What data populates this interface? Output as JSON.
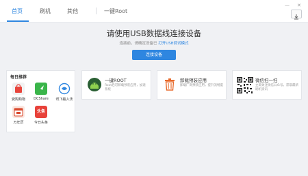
{
  "tabs": [
    {
      "label": "首页"
    },
    {
      "label": "刷机"
    },
    {
      "label": "其他"
    },
    {
      "label": "一键Root"
    }
  ],
  "window_controls": {
    "minimize": "—",
    "close": "✕"
  },
  "hero": {
    "title": "请使用USB数据线连接设备",
    "subtitle_prefix": "连接前，请确定设备已",
    "subtitle_link": "打开USB调试模式",
    "connect_button": "连接设备"
  },
  "daily": {
    "title": "每日推荐",
    "apps": [
      {
        "label": "受购购物",
        "icon": "shopping-bag-icon"
      },
      {
        "label": "DCShare",
        "icon": "dcshare-icon"
      },
      {
        "label": "讯飞输入法",
        "icon": "ifly-input-icon"
      },
      {
        "label": "万年历",
        "icon": "calendar-icon"
      },
      {
        "label": "今日头条",
        "icon": "toutiao-icon",
        "badge": "头条"
      }
    ]
  },
  "cards": [
    {
      "title": "一键ROOT",
      "desc": "Root后可卸载预装应用，加速系统",
      "icon": "root-android-icon"
    },
    {
      "title": "卸载预装应用",
      "desc": "卸载厂商预装应用，提升流畅度",
      "icon": "trash-icon"
    },
    {
      "title": "微信扫一扫",
      "desc": "立即关注微信公众号，获取最新刷机资讯",
      "icon": "qr-code-icon"
    }
  ],
  "colors": {
    "accent": "#2e86e0"
  }
}
